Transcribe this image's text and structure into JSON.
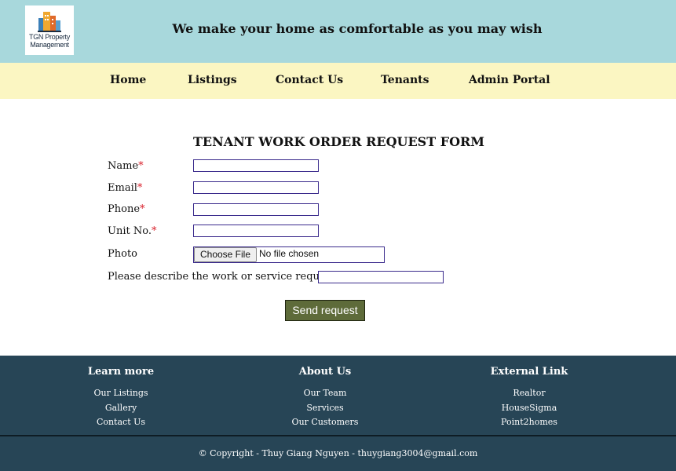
{
  "header": {
    "logo_text_line1": "TGN Property",
    "logo_text_line2": "Management",
    "tagline": "We make your home as comfortable as you may wish"
  },
  "nav": {
    "items": [
      {
        "label": "Home"
      },
      {
        "label": "Listings"
      },
      {
        "label": "Contact Us"
      },
      {
        "label": "Tenants"
      },
      {
        "label": "Admin Portal"
      }
    ]
  },
  "form": {
    "title": "TENANT WORK ORDER REQUEST FORM",
    "required_mark": "*",
    "fields": {
      "name": {
        "label": "Name",
        "value": ""
      },
      "email": {
        "label": "Email",
        "value": ""
      },
      "phone": {
        "label": "Phone",
        "value": ""
      },
      "unit": {
        "label": "Unit No.",
        "value": ""
      },
      "photo": {
        "label": "Photo",
        "button_label": "Choose File",
        "status": "No file chosen"
      },
      "description": {
        "label": "Please describe the work or service required: ",
        "value": ""
      }
    },
    "submit_label": "Send request"
  },
  "footer": {
    "columns": [
      {
        "heading": "Learn more",
        "links": [
          "Our Listings",
          "Gallery",
          "Contact Us"
        ]
      },
      {
        "heading": "About Us",
        "links": [
          "Our Team",
          "Services",
          "Our Customers"
        ]
      },
      {
        "heading": "External Link",
        "links": [
          "Realtor",
          "HouseSigma",
          "Point2homes"
        ]
      }
    ],
    "copyright": "© Copyright - Thuy Giang Nguyen - thuygiang3004@gmail.com"
  },
  "colors": {
    "header_bg": "#a8d8dc",
    "nav_bg": "#fbf6c2",
    "footer_bg": "#274556",
    "button_bg": "#5e6b3a",
    "required_color": "#d9232e"
  }
}
